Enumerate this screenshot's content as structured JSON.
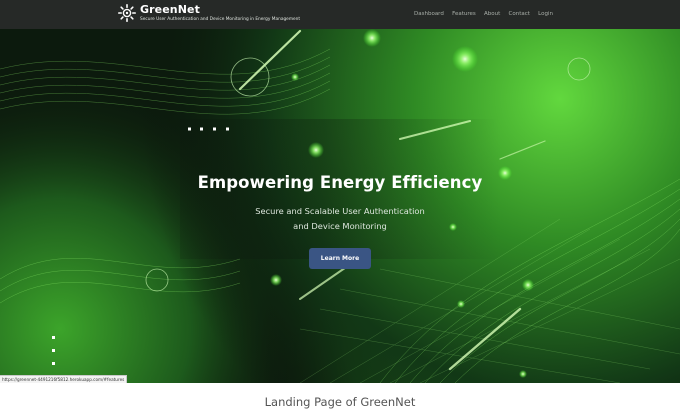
{
  "brand": {
    "name": "GreenNet",
    "tagline": "Secure User Authentication and Device Monitoring in Energy Management"
  },
  "nav": {
    "items": [
      "Dashboard",
      "Features",
      "About",
      "Contact",
      "Login"
    ]
  },
  "hero": {
    "title": "Empowering Energy Efficiency",
    "subtitle_line1": "Secure and Scalable User Authentication",
    "subtitle_line2": "and Device Monitoring",
    "button_label": "Learn More"
  },
  "status_url": "https://greennet-4491216f5812.herokuapp.com/#features",
  "caption": "Landing Page of GreenNet",
  "colors": {
    "navbar": "#262927",
    "button": "#3a5584",
    "accent_green": "#5ee03a"
  },
  "icons": {
    "logo": "sun-gear-logo-icon"
  }
}
